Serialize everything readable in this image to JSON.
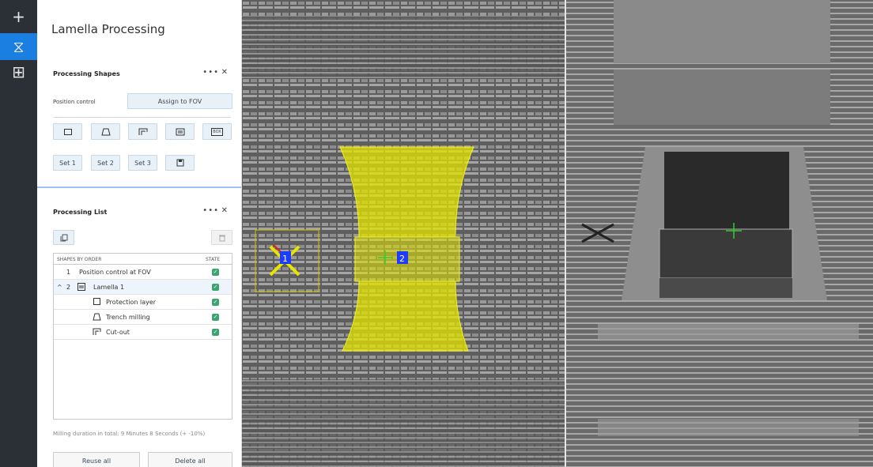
{
  "app": {
    "title": "Lamella Processing"
  },
  "rail": {
    "items": [
      {
        "icon": "plus-icon",
        "glyph": "+"
      },
      {
        "icon": "hourglass-icon",
        "glyph": "⧖"
      },
      {
        "icon": "layout-icon",
        "glyph": "⊞"
      }
    ]
  },
  "shapes_section": {
    "title": "Processing Shapes",
    "menu_glyph": "•••",
    "close_glyph": "✕",
    "position_control_label": "Position control",
    "assign_button": "Assign to FOV",
    "shape_buttons": [
      "rectangle",
      "trapezoid",
      "cut-out",
      "lamella",
      "box"
    ],
    "set_buttons": [
      "Set 1",
      "Set 2",
      "Set 3"
    ],
    "box_label": "BOX"
  },
  "list_section": {
    "title": "Processing List",
    "menu_glyph": "•••",
    "close_glyph": "✕",
    "columns": {
      "shapes": "SHAPES BY ORDER",
      "state": "STATE"
    },
    "rows": [
      {
        "index": "1",
        "name": "Position control at FOV",
        "level": 0,
        "icon": "none"
      },
      {
        "index": "2",
        "name": "Lamella 1",
        "level": 0,
        "icon": "lamella-icon",
        "expanded": true
      },
      {
        "index": "",
        "name": "Protection layer",
        "level": 1,
        "icon": "rectangle-icon"
      },
      {
        "index": "",
        "name": "Trench milling",
        "level": 1,
        "icon": "trapezoid-icon"
      },
      {
        "index": "",
        "name": "Cut-out",
        "level": 1,
        "icon": "cut-out-icon"
      }
    ],
    "duration_text": "Milling duration in total: 9 Minutes 8 Seconds (+ -10%)",
    "reuse_button": "Reuse all",
    "delete_button": "Delete all"
  },
  "view_left": {
    "marker_1": "1",
    "marker_2": "2"
  },
  "colors": {
    "rail_bg": "#2b3036",
    "accent": "#1a7fe0",
    "check_green": "#3aa56f",
    "shape_yellow": "#e6e600",
    "marker_blue": "#1d3cff"
  }
}
